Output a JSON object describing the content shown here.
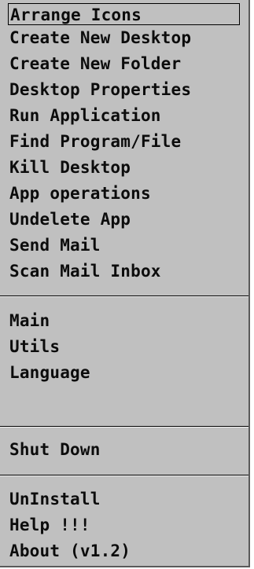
{
  "menu": {
    "groups": [
      {
        "items": [
          "Arrange Icons",
          "Create New Desktop",
          "Create New Folder",
          "Desktop Properties",
          "Run Application",
          "Find Program/File",
          "Kill Desktop",
          "App operations",
          "Undelete App",
          "Send Mail",
          "Scan Mail Inbox"
        ]
      },
      {
        "items": [
          "Main",
          "Utils",
          "Language"
        ]
      },
      {
        "items": [
          "Shut Down"
        ]
      },
      {
        "items": [
          "UnInstall",
          "Help !!!",
          "About (v1.2)"
        ]
      }
    ],
    "selected_item": "Arrange Icons"
  }
}
